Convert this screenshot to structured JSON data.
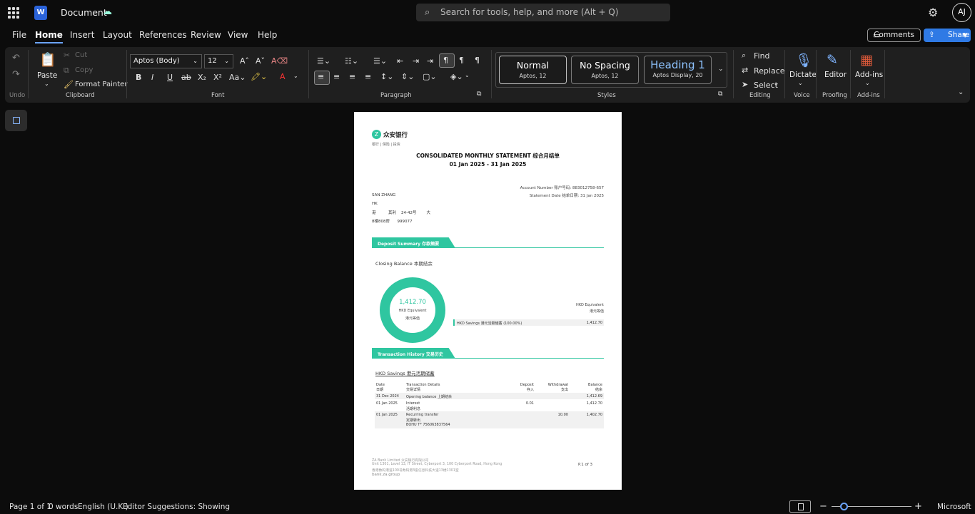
{
  "titlebar": {
    "doc_title": "Document",
    "search_placeholder": "Search for tools, help, and more (Alt + Q)",
    "avatar": "AJ"
  },
  "menu": [
    "File",
    "Home",
    "Insert",
    "Layout",
    "References",
    "Review",
    "View",
    "Help"
  ],
  "actions": {
    "comments": "Comments",
    "share": "Share"
  },
  "ribbon": {
    "clipboard": {
      "cut": "Cut",
      "copy": "Copy",
      "paste": "Paste",
      "format_painter": "Format Painter",
      "label": "Clipboard"
    },
    "undo_label": "Undo",
    "font": {
      "name": "Aptos (Body)",
      "size": "12",
      "label": "Font"
    },
    "paragraph_label": "Paragraph",
    "styles": {
      "items": [
        {
          "name": "Normal",
          "desc": "Aptos, 12"
        },
        {
          "name": "No Spacing",
          "desc": "Aptos, 12"
        },
        {
          "name": "Heading 1",
          "desc": "Aptos Display, 20"
        }
      ],
      "label": "Styles"
    },
    "editing": {
      "find": "Find",
      "replace": "Replace",
      "select": "Select",
      "label": "Editing"
    },
    "voice": {
      "dictate": "Dictate",
      "label": "Voice"
    },
    "proofing": {
      "editor": "Editor",
      "label": "Proofing"
    },
    "addins": {
      "addins": "Add-ins",
      "label": "Add-ins"
    }
  },
  "doc": {
    "bank_name": "众安银行",
    "bank_tagline": "银行 | 保险 | 投资",
    "title": "CONSOLIDATED MONTHLY STATEMENT 综合月结单",
    "period": "01 Jan 2025 - 31 Jan 2025",
    "account_number": "Account Number 账户号码: 883012758-657",
    "statement_date": "Statement Date 结单日期: 31 Jan 2025",
    "address": [
      "SAN ZHANG",
      "HK",
      "港          其利    24-42号        大",
      "8楼808房      999077"
    ],
    "deposit_summary_title": "Deposit Summary 存款摘要",
    "closing_balance_label": "Closing Balance 本期结余",
    "donut": {
      "value": "1,412.70",
      "line1": "HKD Equivalent",
      "line2": "港元等值",
      "percent": 100
    },
    "hkd_equiv_en": "HKD Equivalent",
    "hkd_equiv_cn": "港元等值",
    "savings_row": {
      "label": "HKD Savings 港元活期储蓄 (100.00%)",
      "value": "1,412.70"
    },
    "txn_history_title": "Transaction History 交易历史",
    "account_title": "HKD Savings 港元活期储蓄",
    "table": {
      "headers": [
        {
          "en": "Date",
          "cn": "日期"
        },
        {
          "en": "Transaction Details",
          "cn": "交易详情"
        },
        {
          "en": "Deposit",
          "cn": "存入"
        },
        {
          "en": "Withdrawal",
          "cn": "支出"
        },
        {
          "en": "Balance",
          "cn": "结余"
        }
      ],
      "rows": [
        {
          "date": "31 Dec 2024",
          "details": [
            "Opening balance 上期结余"
          ],
          "deposit": "",
          "withdrawal": "",
          "balance": "1,412.69"
        },
        {
          "date": "01 Jan 2025",
          "details": [
            "Interest",
            "活期利息"
          ],
          "deposit": "0.01",
          "withdrawal": "",
          "balance": "1,412.70"
        },
        {
          "date": "01 Jan 2025",
          "details": [
            "Recurring transfer",
            "定期转出",
            "BOHU T* 756063837564"
          ],
          "deposit": "",
          "withdrawal": "10.00",
          "balance": "1,402.70"
        }
      ]
    },
    "footer": [
      "ZA Bank Limited 众安银行有限公司",
      "Unit 1301, Level 13, IT Street, Cyberport 3, 100 Cyberport Road, Hong Kong",
      "香港数码港道100号数码港3座信息科技大道13楼1301室",
      "bank.za.group"
    ],
    "page_num": "P.1 of 3"
  },
  "status": {
    "page": "Page 1 of 1",
    "words": "0 words",
    "lang": "English (U.K.)",
    "editor": "Editor Suggestions: Showing",
    "brand": "Microsoft"
  },
  "colors": {
    "accent": "#2fc6a0",
    "ribbon": "#1f1f1f",
    "share": "#2f7ae5"
  }
}
